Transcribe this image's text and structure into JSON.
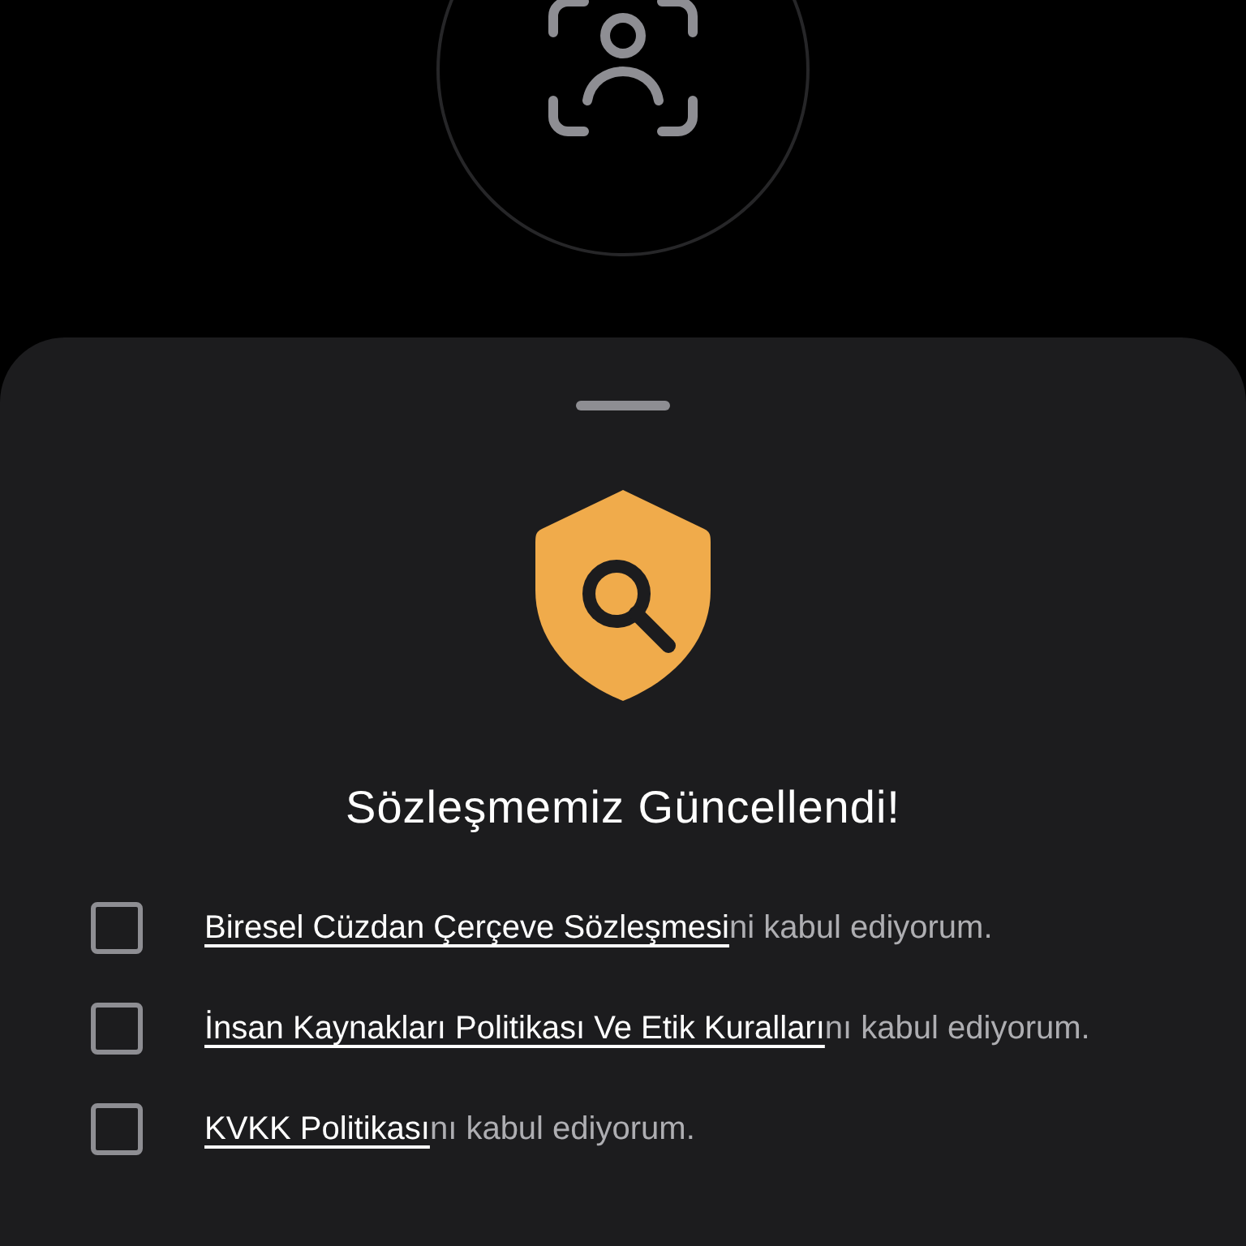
{
  "sheet": {
    "title": "Sözleşmemiz Güncellendi!",
    "items": [
      {
        "link": "Biresel Cüzdan Çerçeve Sözleşmesi",
        "suffix": "ni kabul ediyorum.",
        "checked": false
      },
      {
        "link": "İnsan Kaynakları Politikası Ve Etik Kuralları",
        "suffix": "nı kabul ediyorum.",
        "checked": false
      },
      {
        "link": "KVKK Politikası",
        "suffix": "nı kabul ediyorum.",
        "checked": false
      }
    ]
  }
}
